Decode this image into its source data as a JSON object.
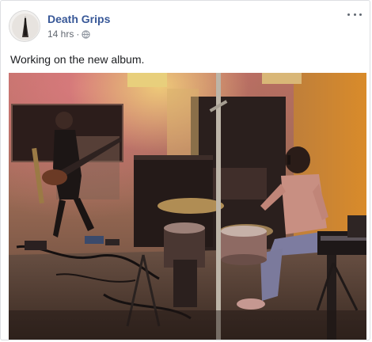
{
  "post": {
    "page_name": "Death Grips",
    "timestamp": "14 hrs",
    "separator": "·",
    "privacy_icon": "globe-icon",
    "text": "Working on the new album.",
    "more_icon": "more-options-icon",
    "photo_subject": "photo"
  }
}
